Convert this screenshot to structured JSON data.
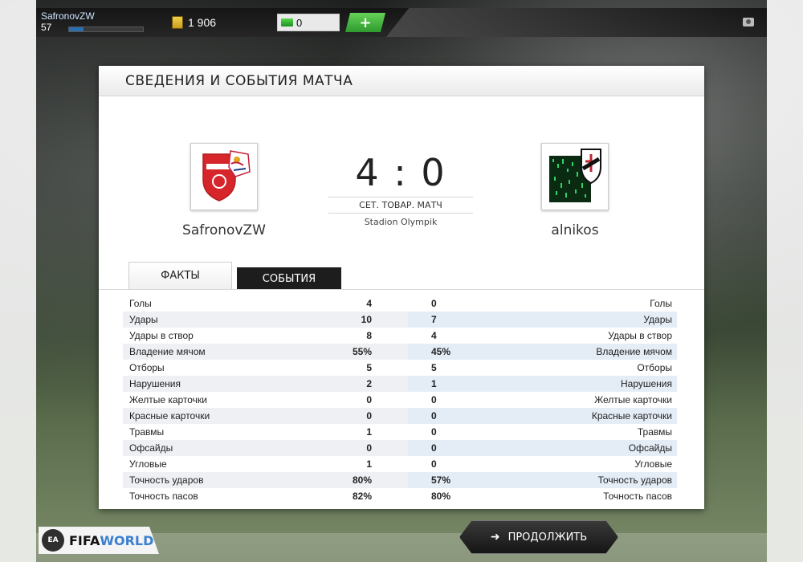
{
  "topbar": {
    "username": "SafronovZW",
    "level": "57",
    "xp_progress_pct": 20,
    "coins": "1 906",
    "fifa_points": "0",
    "add_label": "+"
  },
  "panel": {
    "title": "СВЕДЕНИЯ И СОБЫТИЯ МАТЧА"
  },
  "match": {
    "home_team": "SafronovZW",
    "away_team": "alnikos",
    "score": "4 : 0",
    "match_type": "СЕТ. ТОВАР. МАТЧ",
    "stadium": "Stadion Olympik"
  },
  "tabs": {
    "facts": "ФАКТЫ",
    "events": "СОБЫТИЯ"
  },
  "stats": [
    {
      "label": "Голы",
      "home": "4",
      "away": "0"
    },
    {
      "label": "Удары",
      "home": "10",
      "away": "7"
    },
    {
      "label": "Удары в створ",
      "home": "8",
      "away": "4"
    },
    {
      "label": "Владение мячом",
      "home": "55%",
      "away": "45%"
    },
    {
      "label": "Отборы",
      "home": "5",
      "away": "5"
    },
    {
      "label": "Нарушения",
      "home": "2",
      "away": "1"
    },
    {
      "label": "Желтые карточки",
      "home": "0",
      "away": "0"
    },
    {
      "label": "Красные карточки",
      "home": "0",
      "away": "0"
    },
    {
      "label": "Травмы",
      "home": "1",
      "away": "0"
    },
    {
      "label": "Офсайды",
      "home": "0",
      "away": "0"
    },
    {
      "label": "Угловые",
      "home": "1",
      "away": "0"
    },
    {
      "label": "Точность ударов",
      "home": "80%",
      "away": "57%"
    },
    {
      "label": "Точность пасов",
      "home": "82%",
      "away": "80%"
    }
  ],
  "bottom": {
    "ea_badge": "EA",
    "logo_fifa": "FIFA",
    "logo_world": "WORLD",
    "continue_label": "ПРОДОЛЖИТЬ",
    "continue_icon": "arrow-right-icon"
  }
}
